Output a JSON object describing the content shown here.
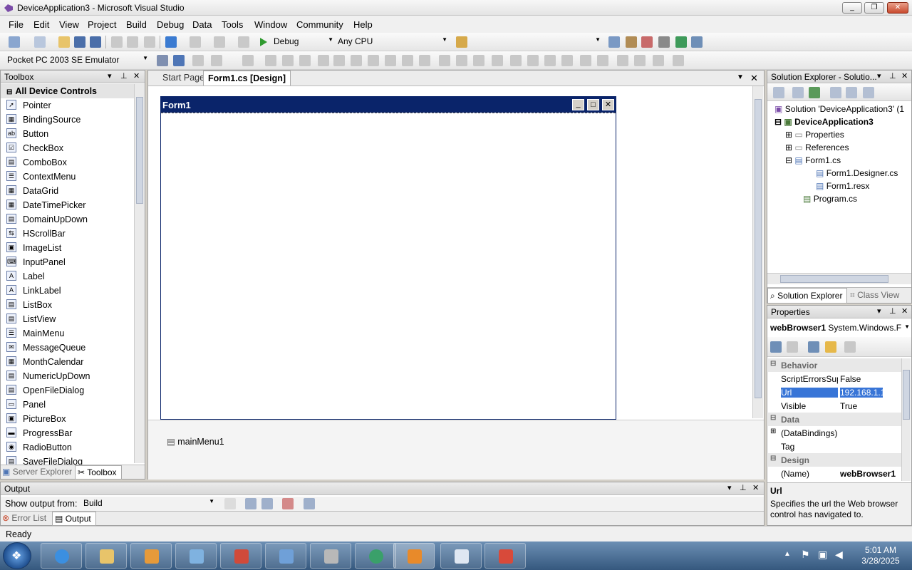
{
  "window": {
    "title": "DeviceApplication3 - Microsoft Visual Studio"
  },
  "menu": [
    "File",
    "Edit",
    "View",
    "Project",
    "Build",
    "Debug",
    "Data",
    "Tools",
    "Window",
    "Community",
    "Help"
  ],
  "toolbar": {
    "config": "Debug",
    "platform": "Any CPU",
    "device": "Pocket PC 2003 SE Emulator"
  },
  "toolbox": {
    "title": "Toolbox",
    "group": "All Device Controls",
    "items": [
      "Pointer",
      "BindingSource",
      "Button",
      "CheckBox",
      "ComboBox",
      "ContextMenu",
      "DataGrid",
      "DateTimePicker",
      "DomainUpDown",
      "HScrollBar",
      "ImageList",
      "InputPanel",
      "Label",
      "LinkLabel",
      "ListBox",
      "ListView",
      "MainMenu",
      "MessageQueue",
      "MonthCalendar",
      "NumericUpDown",
      "OpenFileDialog",
      "Panel",
      "PictureBox",
      "ProgressBar",
      "RadioButton",
      "SaveFileDialog"
    ],
    "tabs": [
      "Server Explorer",
      "Toolbox"
    ]
  },
  "editor": {
    "tabs": [
      "Start Page",
      "Form1.cs [Design]"
    ],
    "form_title": "Form1",
    "component_tray": "mainMenu1"
  },
  "solution_explorer": {
    "title": "Solution Explorer - Solutio...",
    "solution": "Solution 'DeviceApplication3' (1",
    "project": "DeviceApplication3",
    "nodes": [
      "Properties",
      "References",
      "Form1.cs",
      "Form1.Designer.cs",
      "Form1.resx",
      "Program.cs"
    ],
    "tabs": [
      "Solution Explorer",
      "Class View"
    ]
  },
  "properties": {
    "title": "Properties",
    "object": "webBrowser1",
    "type": "System.Windows.F",
    "rows": [
      {
        "cat": true,
        "name": "Behavior",
        "value": ""
      },
      {
        "cat": false,
        "name": "ScriptErrorsSup",
        "value": "False"
      },
      {
        "cat": false,
        "name": "Url",
        "value": "192.168.1.1"
      },
      {
        "cat": false,
        "name": "Visible",
        "value": "True"
      },
      {
        "cat": true,
        "name": "Data",
        "value": ""
      },
      {
        "cat": false,
        "name": "(DataBindings)",
        "value": ""
      },
      {
        "cat": false,
        "name": "Tag",
        "value": ""
      },
      {
        "cat": true,
        "name": "Design",
        "value": ""
      },
      {
        "cat": false,
        "name": "(Name)",
        "value": "webBrowser1"
      }
    ],
    "desc_title": "Url",
    "desc_text": "Specifies the url the Web browser control has navigated to."
  },
  "output": {
    "title": "Output",
    "show_from_label": "Show output from:",
    "show_from_value": "Build",
    "tabs": [
      "Error List",
      "Output"
    ]
  },
  "status": {
    "text": "Ready"
  },
  "clock": {
    "time": "5:01 AM",
    "date": "3/28/2025"
  },
  "colors": {
    "form_caption": "#0a246a",
    "selection": "#3875d7"
  }
}
